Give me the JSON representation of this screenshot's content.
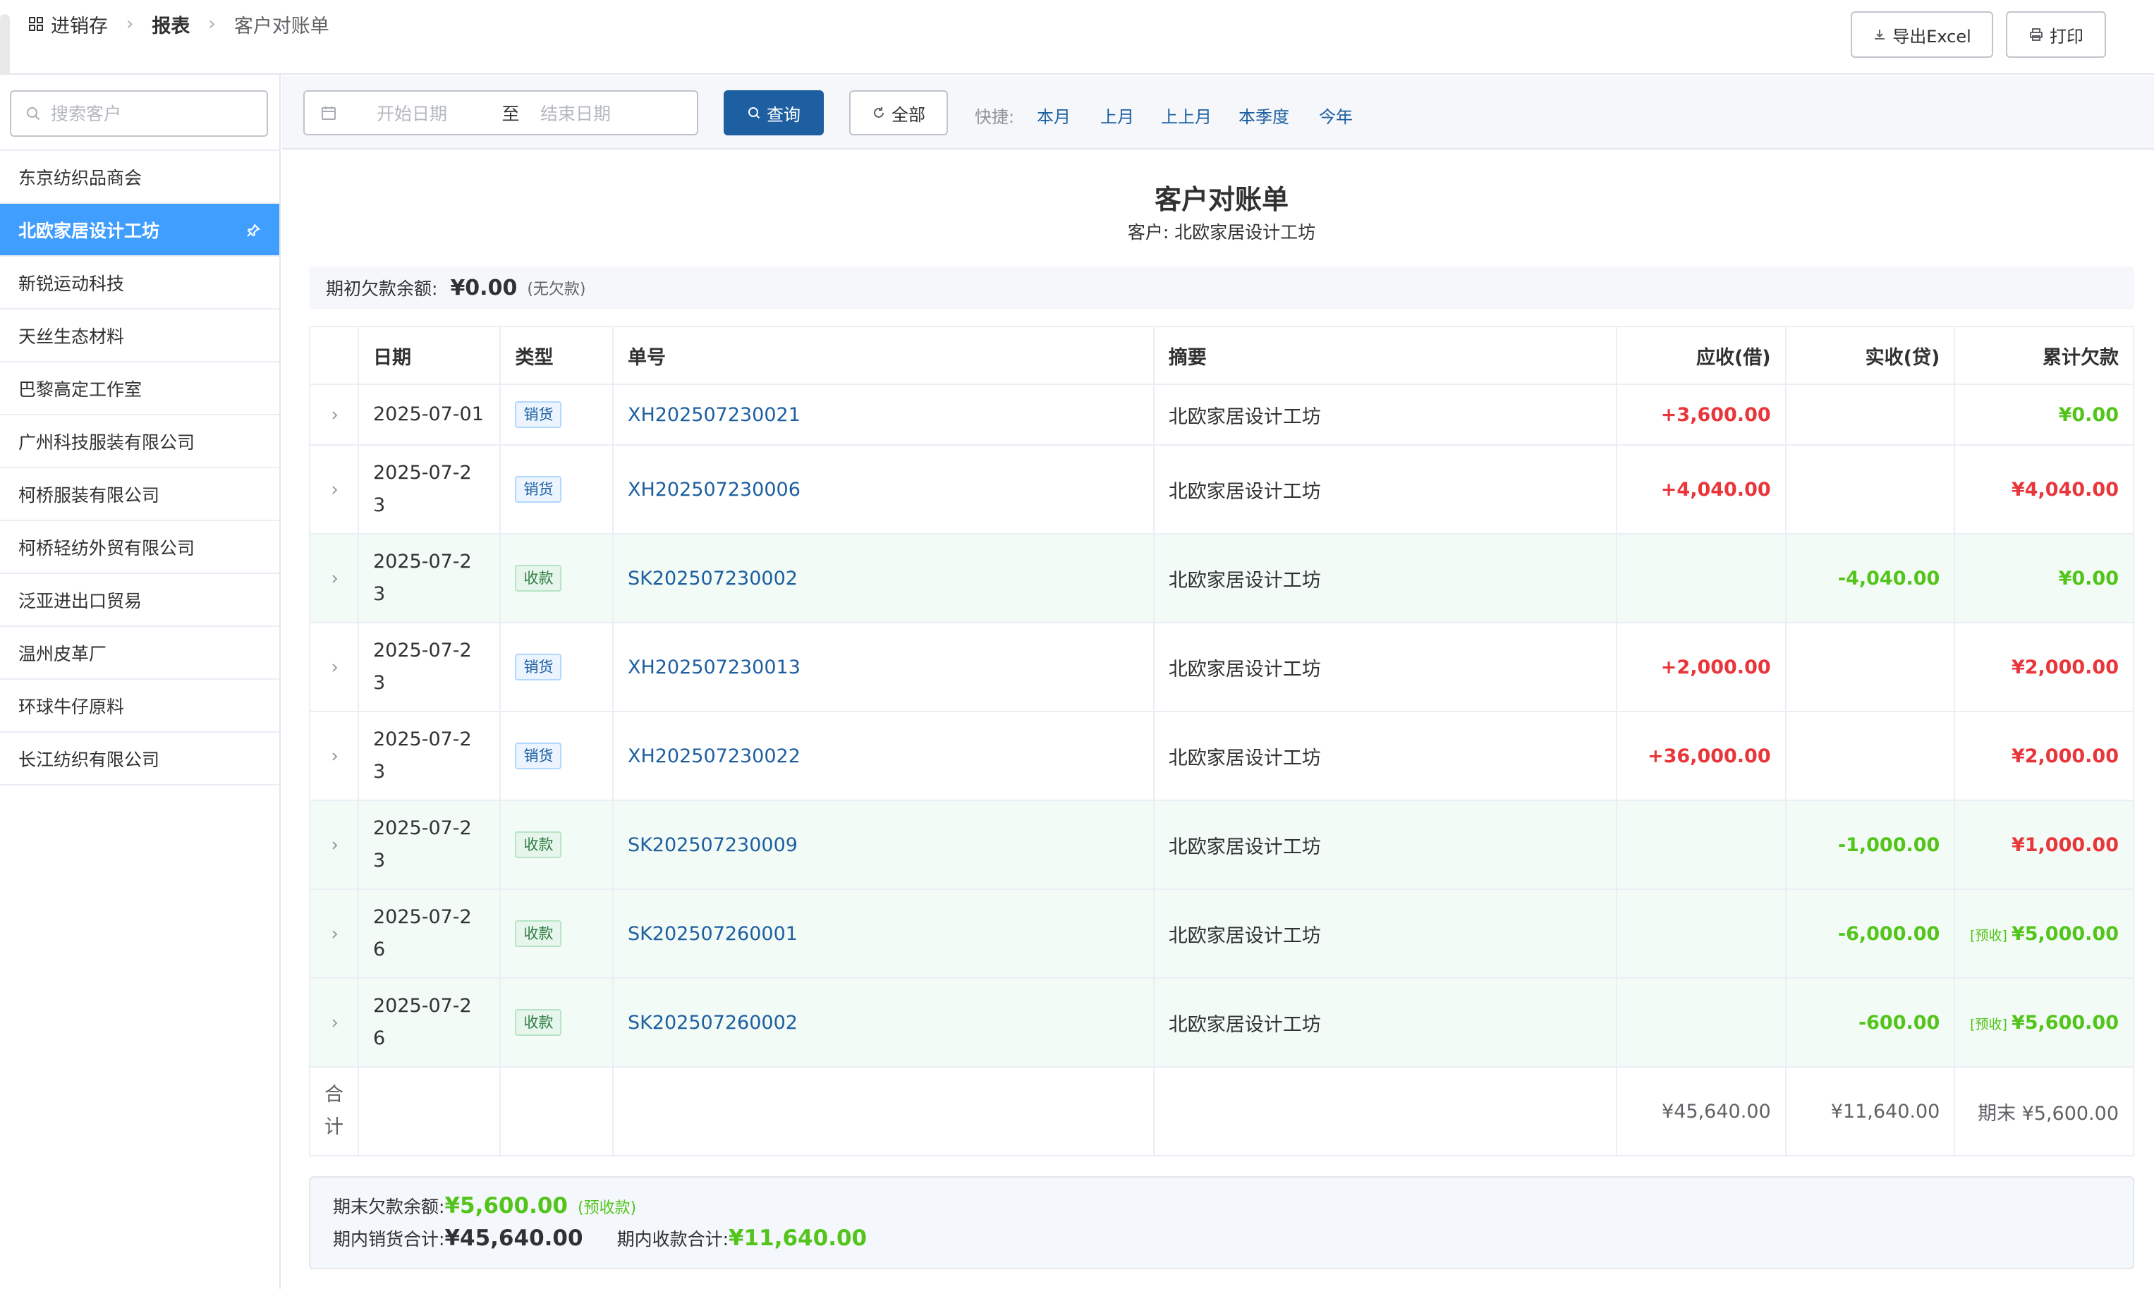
{
  "breadcrumb": {
    "root": "进销存",
    "parent": "报表",
    "current": "客户对账单"
  },
  "header": {
    "export_label": "导出Excel",
    "print_label": "打印"
  },
  "sidebar": {
    "search_placeholder": "搜索客户",
    "customers": [
      "东京纺织品商会",
      "北欧家居设计工坊",
      "新锐运动科技",
      "天丝生态材料",
      "巴黎高定工作室",
      "广州科技服装有限公司",
      "柯桥服装有限公司",
      "柯桥轻纺外贸有限公司",
      "泛亚进出口贸易",
      "温州皮革厂",
      "环球牛仔原料",
      "长江纺织有限公司"
    ],
    "active_index": 1
  },
  "toolbar": {
    "start_placeholder": "开始日期",
    "to_label": "至",
    "end_placeholder": "结束日期",
    "query_label": "查询",
    "all_label": "全部",
    "quick_label": "快捷:",
    "quick_links": [
      "本月",
      "上月",
      "上上月",
      "本季度",
      "今年"
    ]
  },
  "report": {
    "title": "客户对账单",
    "customer_line": "客户: 北欧家居设计工坊",
    "opening_label": "期初欠款余额:",
    "opening_amount": "¥0.00",
    "opening_note": "(无欠款)"
  },
  "table": {
    "headers": {
      "date": "日期",
      "type": "类型",
      "doc_no": "单号",
      "summary": "摘要",
      "debit": "应收(借)",
      "credit": "实收(贷)",
      "balance": "累计欠款"
    },
    "rows": [
      {
        "date_a": "2025-07-01",
        "date_b": "",
        "type": "销货",
        "doc_no": "XH202507230021",
        "summary": "北欧家居设计工坊",
        "debit": "+3,600.00",
        "credit": "",
        "balance": "¥0.00",
        "balance_prefix": ""
      },
      {
        "date_a": "2025-07-2",
        "date_b": "3",
        "type": "销货",
        "doc_no": "XH202507230006",
        "summary": "北欧家居设计工坊",
        "debit": "+4,040.00",
        "credit": "",
        "balance": "¥4,040.00",
        "balance_prefix": ""
      },
      {
        "date_a": "2025-07-2",
        "date_b": "3",
        "type": "收款",
        "doc_no": "SK202507230002",
        "summary": "北欧家居设计工坊",
        "debit": "",
        "credit": "-4,040.00",
        "balance": "¥0.00",
        "balance_prefix": ""
      },
      {
        "date_a": "2025-07-2",
        "date_b": "3",
        "type": "销货",
        "doc_no": "XH202507230013",
        "summary": "北欧家居设计工坊",
        "debit": "+2,000.00",
        "credit": "",
        "balance": "¥2,000.00",
        "balance_prefix": ""
      },
      {
        "date_a": "2025-07-2",
        "date_b": "3",
        "type": "销货",
        "doc_no": "XH202507230022",
        "summary": "北欧家居设计工坊",
        "debit": "+36,000.00",
        "credit": "",
        "balance": "¥2,000.00",
        "balance_prefix": ""
      },
      {
        "date_a": "2025-07-2",
        "date_b": "3",
        "type": "收款",
        "doc_no": "SK202507230009",
        "summary": "北欧家居设计工坊",
        "debit": "",
        "credit": "-1,000.00",
        "balance": "¥1,000.00",
        "balance_prefix": ""
      },
      {
        "date_a": "2025-07-2",
        "date_b": "6",
        "type": "收款",
        "doc_no": "SK202507260001",
        "summary": "北欧家居设计工坊",
        "debit": "",
        "credit": "-6,000.00",
        "balance": "¥5,000.00",
        "balance_prefix": "[预收]"
      },
      {
        "date_a": "2025-07-2",
        "date_b": "6",
        "type": "收款",
        "doc_no": "SK202507260002",
        "summary": "北欧家居设计工坊",
        "debit": "",
        "credit": "-600.00",
        "balance": "¥5,600.00",
        "balance_prefix": "[预收]"
      }
    ],
    "total": {
      "label_a": "合",
      "label_b": "计",
      "debit": "¥45,640.00",
      "credit": "¥11,640.00",
      "balance": "期末 ¥5,600.00"
    }
  },
  "summary": {
    "closing_label": "期末欠款余额:",
    "closing_amount": "¥5,600.00",
    "closing_note": "(预收款)",
    "sales_label": "期内销货合计:",
    "sales_amount": "¥45,640.00",
    "receipts_label": "期内收款合计:",
    "receipts_amount": "¥11,640.00"
  },
  "colors": {
    "primary": "#1d5fa0",
    "active": "#409eff",
    "debit_red": "#e8363b",
    "credit_green": "#52c41a",
    "receipt_row_bg": "#f3fbf6"
  },
  "icons": [
    "grid-icon",
    "chevron-right-icon",
    "download-icon",
    "printer-icon",
    "search-icon",
    "pin-icon",
    "calendar-icon",
    "refresh-icon",
    "expand-icon"
  ]
}
